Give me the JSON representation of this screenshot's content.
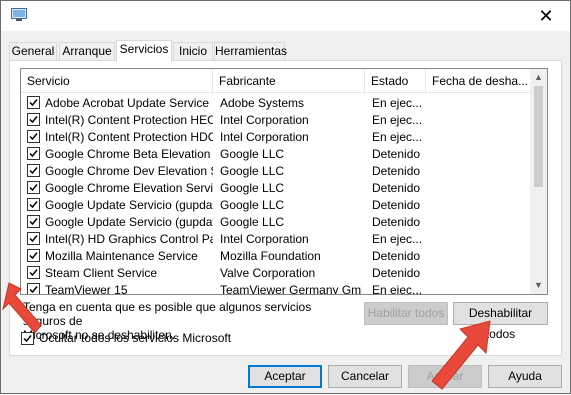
{
  "window": {
    "close_glyph": "✕"
  },
  "tabs": [
    {
      "label": "General",
      "active": false
    },
    {
      "label": "Arranque",
      "active": false
    },
    {
      "label": "Servicios",
      "active": true
    },
    {
      "label": "Inicio",
      "active": false
    },
    {
      "label": "Herramientas",
      "active": false
    }
  ],
  "services": {
    "columns": [
      "Servicio",
      "Fabricante",
      "Estado",
      "Fecha de desha..."
    ],
    "rows": [
      {
        "checked": true,
        "name": "Adobe Acrobat Update Service",
        "maker": "Adobe Systems",
        "status": "En ejec..."
      },
      {
        "checked": true,
        "name": "Intel(R) Content Protection HEC...",
        "maker": "Intel Corporation",
        "status": "En ejec..."
      },
      {
        "checked": true,
        "name": "Intel(R) Content Protection HDC...",
        "maker": "Intel Corporation",
        "status": "En ejec..."
      },
      {
        "checked": true,
        "name": "Google Chrome Beta Elevation S...",
        "maker": "Google LLC",
        "status": "Detenido"
      },
      {
        "checked": true,
        "name": "Google Chrome Dev Elevation S...",
        "maker": "Google LLC",
        "status": "Detenido"
      },
      {
        "checked": true,
        "name": "Google Chrome Elevation Service",
        "maker": "Google LLC",
        "status": "Detenido"
      },
      {
        "checked": true,
        "name": "Google Update Servicio (gupdate)",
        "maker": "Google LLC",
        "status": "Detenido"
      },
      {
        "checked": true,
        "name": "Google Update Servicio (gupdatem)",
        "maker": "Google LLC",
        "status": "Detenido"
      },
      {
        "checked": true,
        "name": "Intel(R) HD Graphics Control Pa...",
        "maker": "Intel Corporation",
        "status": "En ejec..."
      },
      {
        "checked": true,
        "name": "Mozilla Maintenance Service",
        "maker": "Mozilla Foundation",
        "status": "Detenido"
      },
      {
        "checked": true,
        "name": "Steam Client Service",
        "maker": "Valve Corporation",
        "status": "Detenido"
      },
      {
        "checked": true,
        "name": "TeamViewer 15",
        "maker": "TeamViewer Germany GmbH",
        "status": "En ejec..."
      }
    ]
  },
  "note": {
    "line1": "Tenga en cuenta que es posible que algunos servicios seguros de",
    "line2": "Microsoft no se deshabiliten."
  },
  "buttons": {
    "enable_all": "Habilitar todos",
    "disable_all": "Deshabilitar todos",
    "accept": "Aceptar",
    "cancel": "Cancelar",
    "apply": "Aplicar",
    "help": "Ayuda"
  },
  "hide_ms": {
    "checked": true,
    "label": "Ocultar todos los servicios Microsoft"
  },
  "colors": {
    "accent": "#0078d7",
    "arrow": "#e8493a"
  }
}
